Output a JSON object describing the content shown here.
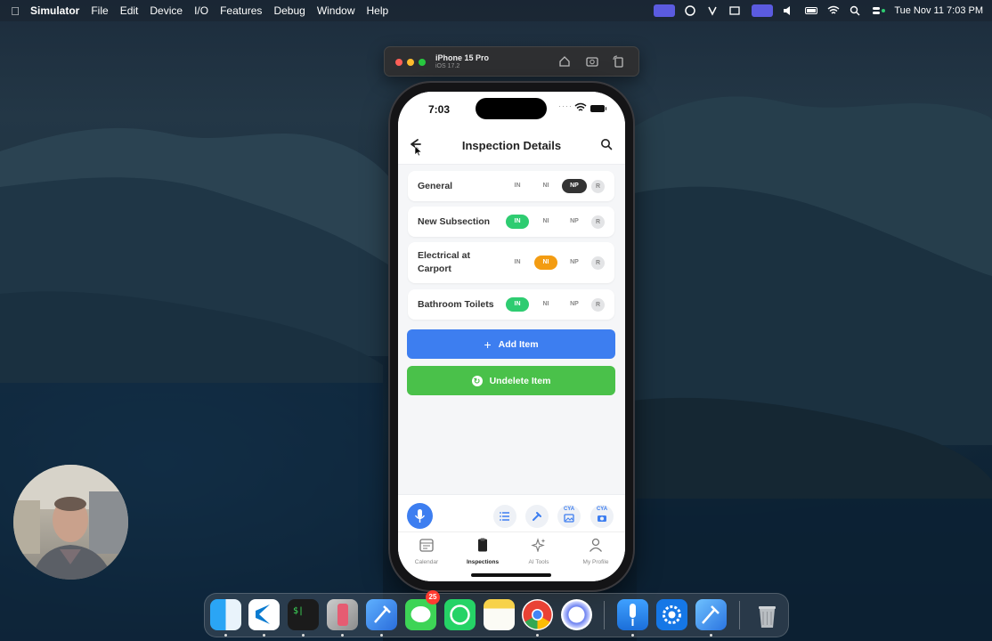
{
  "menubar": {
    "apple_icon": "apple-logo-icon",
    "app_name": "Simulator",
    "menus": [
      "File",
      "Edit",
      "Device",
      "I/O",
      "Features",
      "Debug",
      "Window",
      "Help"
    ],
    "clock": "Tue Nov 11  7:03 PM"
  },
  "simulator": {
    "device_name": "iPhone 15 Pro",
    "os_version": "iOS 17.2"
  },
  "phone": {
    "status_time": "7:03",
    "header_title": "Inspection Details",
    "sections": [
      {
        "label": "General",
        "in": "IN",
        "ni": "NI",
        "np": "NP",
        "r": "R",
        "selected": "NP"
      },
      {
        "label": "New Subsection",
        "in": "IN",
        "ni": "NI",
        "np": "NP",
        "r": "R",
        "selected": "IN"
      },
      {
        "label": "Electrical at Carport",
        "in": "IN",
        "ni": "NI",
        "np": "NP",
        "r": "R",
        "selected": "NI"
      },
      {
        "label": "Bathroom Toilets",
        "in": "IN",
        "ni": "NI",
        "np": "NP",
        "r": "R",
        "selected": "IN"
      }
    ],
    "add_item_label": "Add Item",
    "undelete_item_label": "Undelete Item",
    "tools": {
      "cya_photos": "CYA",
      "cya_camera": "CYA"
    },
    "tabs": [
      {
        "label": "Calendar",
        "icon": "calendar-icon"
      },
      {
        "label": "Inspections",
        "icon": "clipboard-icon",
        "active": true
      },
      {
        "label": "AI Tools",
        "icon": "sparkles-icon"
      },
      {
        "label": "My Profile",
        "icon": "profile-icon"
      }
    ]
  },
  "dock": {
    "apps": [
      "Finder",
      "Visual Studio Code",
      "Terminal",
      "Simulator",
      "Xcode",
      "Messages",
      "WhatsApp",
      "Notes",
      "Chrome",
      "Siri",
      "Voice Memos",
      "Settings",
      "Xcode Instruments",
      "Trash"
    ],
    "messages_badge": "25"
  },
  "colors": {
    "accent_blue": "#3d7ef0",
    "success_green": "#4ac14a",
    "status_in_green": "#2ecc71",
    "status_ni_orange": "#f39c12",
    "status_np_dark": "#333333"
  }
}
